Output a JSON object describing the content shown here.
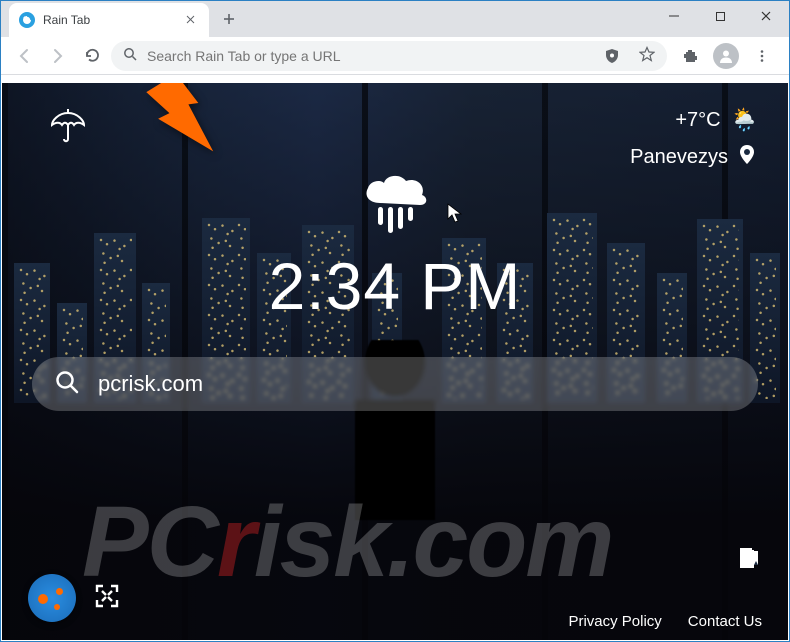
{
  "window": {
    "tab_title": "Rain Tab",
    "omnibox_placeholder": "Search Rain Tab or type a URL"
  },
  "newtab": {
    "weather": {
      "temp": "+7°C"
    },
    "location": "Panevezys",
    "clock": "2:34 PM",
    "search_value": "pcrisk.com"
  },
  "footer": {
    "privacy": "Privacy Policy",
    "contact": "Contact Us"
  },
  "watermark": {
    "prefix": "PC",
    "r": "r",
    "suffix": "isk.com"
  }
}
